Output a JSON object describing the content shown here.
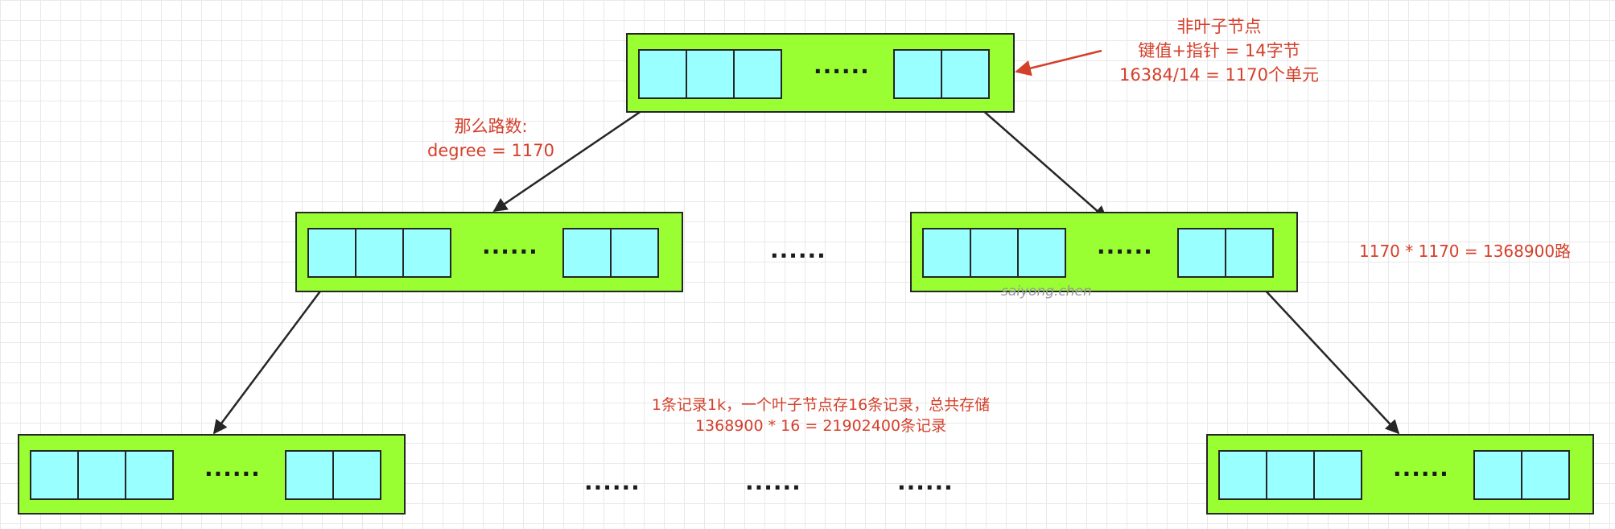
{
  "annotations": {
    "non_leaf_title": "非叶子节点",
    "key_pointer": "键值+指针 = 14字节",
    "units_calc": "16384/14 = 1170个单元",
    "branch_title": "那么路数:",
    "degree": "degree = 1170",
    "paths_calc": "1170 * 1170 = 1368900路",
    "leaf_line1": "1条记录1k，一个叶子节点存16条记录，总共存储",
    "leaf_line2": "1368900 * 16 = 21902400条记录"
  },
  "watermark": "saiyong.chen",
  "ellipsis": "......",
  "colors": {
    "node_fill": "#99ff33",
    "cell_fill": "#99ffff",
    "border": "#262626",
    "annotation_text": "#d43f2a",
    "pointer_arrow": "#d43f2a"
  }
}
